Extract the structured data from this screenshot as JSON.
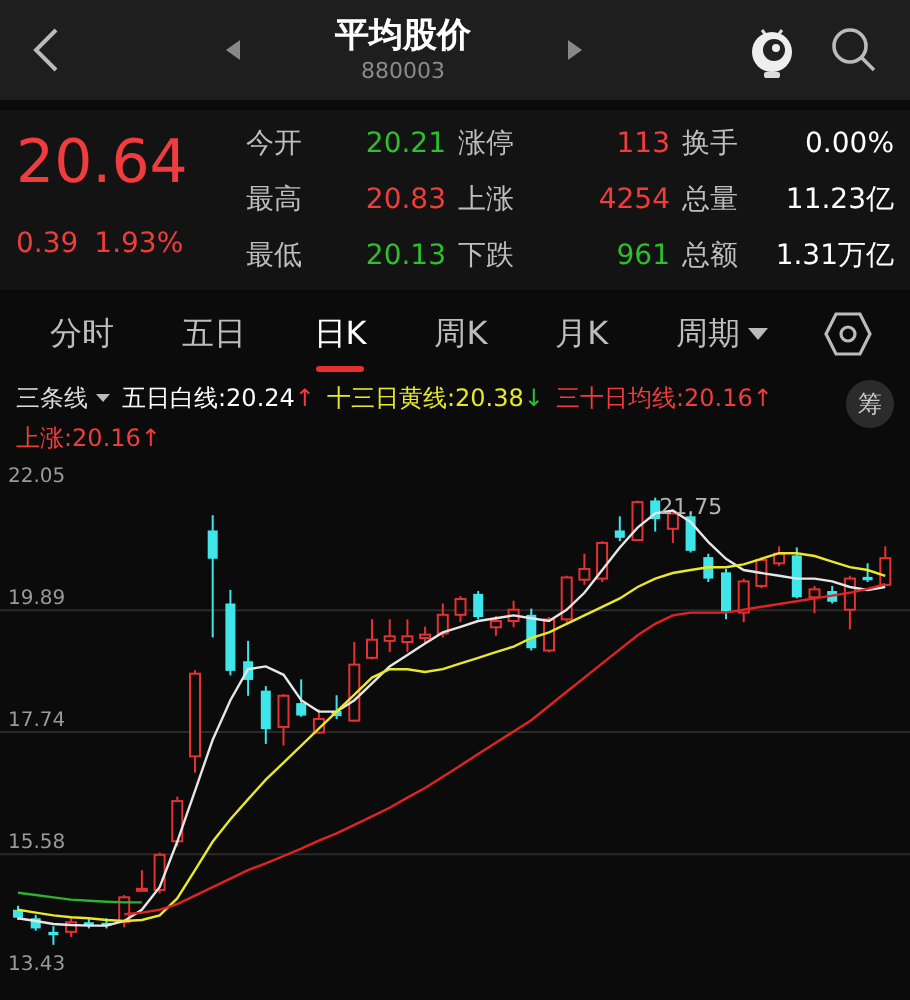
{
  "header": {
    "title": "平均股价",
    "code": "880003"
  },
  "quote": {
    "price": "20.64",
    "change": "0.39",
    "change_percent": "1.93%",
    "color": "#f03c3c",
    "stats": [
      {
        "label": "今开",
        "value": "20.21",
        "color": "#2dbf2d"
      },
      {
        "label": "涨停",
        "value": "113",
        "color": "#f03c3c"
      },
      {
        "label": "换手",
        "value": "0.00%",
        "color": "#ffffff"
      },
      {
        "label": "最高",
        "value": "20.83",
        "color": "#f03c3c"
      },
      {
        "label": "上涨",
        "value": "4254",
        "color": "#f03c3c"
      },
      {
        "label": "总量",
        "value": "11.23亿",
        "color": "#ffffff"
      },
      {
        "label": "最低",
        "value": "20.13",
        "color": "#2dbf2d"
      },
      {
        "label": "下跌",
        "value": "961",
        "color": "#2dbf2d"
      },
      {
        "label": "总额",
        "value": "1.31万亿",
        "color": "#ffffff"
      }
    ]
  },
  "tabs": [
    {
      "label": "分时",
      "kind": "tab",
      "selected": false
    },
    {
      "label": "五日",
      "kind": "tab",
      "selected": false
    },
    {
      "label": "日K",
      "kind": "tab",
      "selected": true
    },
    {
      "label": "周K",
      "kind": "tab",
      "selected": false
    },
    {
      "label": "月K",
      "kind": "tab",
      "selected": false
    },
    {
      "label": "周期",
      "kind": "dropdown",
      "selected": false
    }
  ],
  "legend": {
    "selector": "三条线",
    "items": [
      {
        "label": "五日白线:",
        "value": "20.24",
        "arrow": {
          "text": "↑",
          "color": "#f03c3c"
        },
        "color": "#ffffff"
      },
      {
        "label": "十三日黄线:",
        "value": "20.38",
        "arrow": {
          "text": "↓",
          "color": "#2dbf2d"
        },
        "color": "#e8e82c"
      },
      {
        "label": "三十日均线:",
        "value": "20.16",
        "arrow": {
          "text": "↑",
          "color": "#f03c3c"
        },
        "color": "#f03c3c"
      },
      {
        "label": "上涨:",
        "value": "20.16",
        "arrow": {
          "text": "↑",
          "color": "#f03c3c"
        },
        "color": "#f03c3c"
      }
    ]
  },
  "side_button": "筹",
  "chart_data": {
    "type": "candlestick",
    "ylim": [
      13.43,
      22.05
    ],
    "grid": true,
    "yticks": [
      {
        "value": 22.05,
        "label": "22.05"
      },
      {
        "value": 19.89,
        "label": "19.89"
      },
      {
        "value": 17.74,
        "label": "17.74"
      },
      {
        "value": 15.58,
        "label": "15.58"
      },
      {
        "value": 13.43,
        "label": "13.43"
      }
    ],
    "annotations": [
      {
        "text": "21.75"
      }
    ],
    "series": [
      {
        "type": "line",
        "color": "#e6e6e6",
        "values": [
          14.45,
          14.4,
          14.35,
          14.33,
          14.32,
          14.32,
          14.4,
          14.6,
          15.0,
          15.8,
          16.7,
          17.6,
          18.3,
          18.85,
          18.9,
          18.75,
          18.3,
          18.1,
          18.1,
          18.3,
          18.6,
          18.9,
          19.1,
          19.3,
          19.5,
          19.6,
          19.7,
          19.75,
          19.8,
          19.75,
          19.7,
          19.9,
          20.2,
          20.6,
          21.0,
          21.35,
          21.6,
          21.65,
          21.45,
          21.1,
          20.8,
          20.6,
          20.55,
          20.5,
          20.45,
          20.45,
          20.4,
          20.3,
          20.25,
          20.3
        ]
      },
      {
        "type": "line",
        "color": "#e8e82c",
        "values": [
          14.6,
          14.55,
          14.5,
          14.47,
          14.45,
          14.42,
          14.4,
          14.42,
          14.5,
          14.8,
          15.3,
          15.8,
          16.2,
          16.55,
          16.9,
          17.2,
          17.5,
          17.8,
          18.1,
          18.4,
          18.7,
          18.85,
          18.85,
          18.8,
          18.85,
          18.95,
          19.05,
          19.15,
          19.25,
          19.4,
          19.5,
          19.65,
          19.8,
          19.95,
          20.1,
          20.3,
          20.45,
          20.55,
          20.6,
          20.65,
          20.65,
          20.7,
          20.8,
          20.9,
          20.9,
          20.85,
          20.75,
          20.65,
          20.6,
          20.5
        ]
      },
      {
        "type": "line",
        "color": "#e02424",
        "values": [
          null,
          null,
          null,
          null,
          null,
          null,
          14.52,
          14.55,
          14.6,
          14.7,
          14.85,
          15.0,
          15.15,
          15.3,
          15.42,
          15.55,
          15.68,
          15.82,
          15.95,
          16.1,
          16.25,
          16.4,
          16.58,
          16.75,
          16.95,
          17.15,
          17.35,
          17.55,
          17.75,
          17.95,
          18.2,
          18.45,
          18.7,
          18.95,
          19.2,
          19.45,
          19.65,
          19.8,
          19.85,
          19.85,
          19.85,
          19.9,
          19.95,
          20.0,
          20.05,
          20.1,
          20.15,
          20.2,
          20.27,
          20.35
        ]
      },
      {
        "type": "line",
        "color": "#2fb02f",
        "values": [
          14.9,
          14.86,
          14.82,
          14.78,
          14.76,
          14.74,
          14.73,
          14.73,
          null,
          null,
          null,
          null,
          null,
          null,
          null,
          null,
          null,
          null,
          null,
          null,
          null,
          null,
          null,
          null,
          null,
          null,
          null,
          null,
          null,
          null,
          null,
          null,
          null,
          null,
          null,
          null,
          null,
          null,
          null,
          null,
          null,
          null,
          null,
          null,
          null,
          null,
          null,
          null,
          null,
          null
        ]
      }
    ],
    "ohlc": [
      [
        14.6,
        14.67,
        14.42,
        14.46
      ],
      [
        14.45,
        14.51,
        14.23,
        14.27
      ],
      [
        14.21,
        14.31,
        13.98,
        14.15
      ],
      [
        14.21,
        14.45,
        14.12,
        14.38
      ],
      [
        14.38,
        14.45,
        14.27,
        14.33
      ],
      [
        14.37,
        14.45,
        14.27,
        14.32
      ],
      [
        14.38,
        14.86,
        14.29,
        14.82
      ],
      [
        14.95,
        15.3,
        14.93,
        14.97
      ],
      [
        14.95,
        15.61,
        14.89,
        15.57
      ],
      [
        15.81,
        16.6,
        15.72,
        16.52
      ],
      [
        17.31,
        18.83,
        17.02,
        18.77
      ],
      [
        21.3,
        21.57,
        19.41,
        20.8
      ],
      [
        20.01,
        20.25,
        18.74,
        18.82
      ],
      [
        18.99,
        19.35,
        18.38,
        18.66
      ],
      [
        18.47,
        18.55,
        17.53,
        17.79
      ],
      [
        17.83,
        18.41,
        17.5,
        18.38
      ],
      [
        18.25,
        18.67,
        18.01,
        18.03
      ],
      [
        17.73,
        18.14,
        17.71,
        17.97
      ],
      [
        18.11,
        18.39,
        17.97,
        18.02
      ],
      [
        17.94,
        19.33,
        17.92,
        18.93
      ],
      [
        19.05,
        19.73,
        19.02,
        19.37
      ],
      [
        19.35,
        19.73,
        19.15,
        19.43
      ],
      [
        19.33,
        19.73,
        19.15,
        19.43
      ],
      [
        19.4,
        19.6,
        19.3,
        19.46
      ],
      [
        19.48,
        20.01,
        19.41,
        19.81
      ],
      [
        19.81,
        20.14,
        19.68,
        20.09
      ],
      [
        20.18,
        20.23,
        19.73,
        19.77
      ],
      [
        19.59,
        19.79,
        19.44,
        19.7
      ],
      [
        19.7,
        20.06,
        19.59,
        19.9
      ],
      [
        19.81,
        19.92,
        19.18,
        19.22
      ],
      [
        19.18,
        19.77,
        19.15,
        19.73
      ],
      [
        19.73,
        20.5,
        19.68,
        20.47
      ],
      [
        20.43,
        20.89,
        20.34,
        20.62
      ],
      [
        20.45,
        21.11,
        20.39,
        21.08
      ],
      [
        21.3,
        21.55,
        21.11,
        21.17
      ],
      [
        21.13,
        21.83,
        21.11,
        21.8
      ],
      [
        21.83,
        21.88,
        21.28,
        21.5
      ],
      [
        21.33,
        21.64,
        21.08,
        21.6
      ],
      [
        21.55,
        21.61,
        20.91,
        20.94
      ],
      [
        20.83,
        20.89,
        20.39,
        20.45
      ],
      [
        20.56,
        20.62,
        19.73,
        19.87
      ],
      [
        19.85,
        20.45,
        19.68,
        20.4
      ],
      [
        20.32,
        20.83,
        20.28,
        20.78
      ],
      [
        20.72,
        21.02,
        20.67,
        20.89
      ],
      [
        20.86,
        21.0,
        20.1,
        20.12
      ],
      [
        20.12,
        20.32,
        19.84,
        20.26
      ],
      [
        20.23,
        20.32,
        20.01,
        20.04
      ],
      [
        19.9,
        20.5,
        19.55,
        20.45
      ],
      [
        20.48,
        20.72,
        20.39,
        20.42
      ],
      [
        20.34,
        21.02,
        20.32,
        20.81
      ]
    ]
  }
}
